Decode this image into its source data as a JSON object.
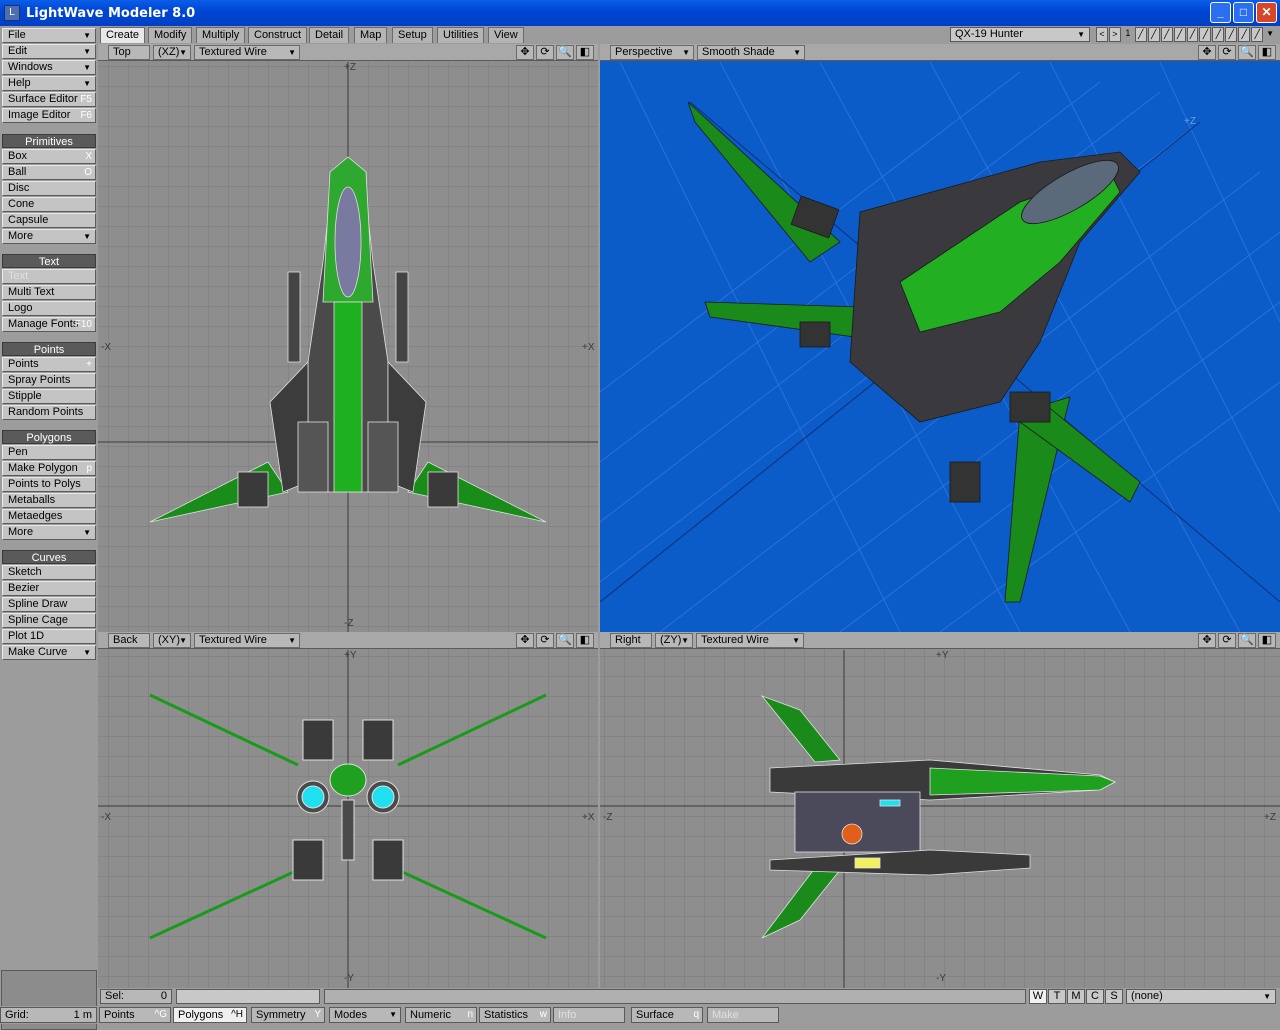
{
  "window": {
    "title": "LightWave Modeler 8.0",
    "app_icon": "lw-icon"
  },
  "menu": [
    {
      "label": "File",
      "dropdown": true
    },
    {
      "label": "Edit",
      "dropdown": true
    },
    {
      "label": "Windows",
      "dropdown": true
    },
    {
      "label": "Help",
      "dropdown": true
    },
    {
      "label": "Surface Editor",
      "shortcut": "F5"
    },
    {
      "label": "Image Editor",
      "shortcut": "F6"
    }
  ],
  "sections": {
    "primitives": {
      "title": "Primitives",
      "items": [
        {
          "label": "Box",
          "shortcut": "X"
        },
        {
          "label": "Ball",
          "shortcut": "O"
        },
        {
          "label": "Disc",
          "shortcut": ""
        },
        {
          "label": "Cone",
          "shortcut": ""
        },
        {
          "label": "Capsule",
          "shortcut": ""
        },
        {
          "label": "More",
          "shortcut": ""
        }
      ]
    },
    "text": {
      "title": "Text",
      "items": [
        {
          "label": "Text",
          "shortcut": ""
        },
        {
          "label": "Multi Text",
          "shortcut": ""
        },
        {
          "label": "Logo",
          "shortcut": ""
        },
        {
          "label": "Manage Fonts",
          "shortcut": "F10"
        }
      ]
    },
    "points": {
      "title": "Points",
      "items": [
        {
          "label": "Points",
          "shortcut": "+"
        },
        {
          "label": "Spray Points",
          "shortcut": ""
        },
        {
          "label": "Stipple",
          "shortcut": ""
        },
        {
          "label": "Random Points",
          "shortcut": ""
        }
      ]
    },
    "polygons": {
      "title": "Polygons",
      "items": [
        {
          "label": "Pen",
          "shortcut": ""
        },
        {
          "label": "Make Polygon",
          "shortcut": "p"
        },
        {
          "label": "Points to Polys",
          "shortcut": ""
        },
        {
          "label": "Metaballs",
          "shortcut": ""
        },
        {
          "label": "Metaedges",
          "shortcut": ""
        },
        {
          "label": "More",
          "shortcut": ""
        }
      ]
    },
    "curves": {
      "title": "Curves",
      "items": [
        {
          "label": "Sketch",
          "shortcut": ""
        },
        {
          "label": "Bezier",
          "shortcut": ""
        },
        {
          "label": "Spline Draw",
          "shortcut": ""
        },
        {
          "label": "Spline Cage",
          "shortcut": ""
        },
        {
          "label": "Plot 1D",
          "shortcut": ""
        },
        {
          "label": "Make Curve",
          "shortcut": ""
        }
      ]
    }
  },
  "tabs": [
    "Create",
    "Modify",
    "Multiply",
    "Construct",
    "Detail",
    "Map",
    "Setup",
    "Utilities",
    "View"
  ],
  "active_tab": "Create",
  "object_selector": "QX-19 Hunter",
  "layer_number": "1",
  "viewports": {
    "top": {
      "view": "Top",
      "axes": "(XZ)",
      "mode": "Textured Wire",
      "labels": {
        "top": "+Z",
        "bottom": "-Z",
        "left": "-X",
        "right": "+X"
      }
    },
    "perspective": {
      "view": "Perspective",
      "mode": "Smooth Shade",
      "labels": {
        "axis": "+Z"
      }
    },
    "back": {
      "view": "Back",
      "axes": "(XY)",
      "mode": "Textured Wire",
      "labels": {
        "top": "+Y",
        "bottom": "-Y",
        "left": "-X",
        "right": "+X"
      }
    },
    "right": {
      "view": "Right",
      "axes": "(ZY)",
      "mode": "Textured Wire",
      "labels": {
        "top": "+Y",
        "bottom": "-Y",
        "left": "-Z",
        "right": "+Z"
      }
    }
  },
  "status": {
    "sel_label": "Sel:",
    "sel_value": "0",
    "wtmcs": [
      "W",
      "T",
      "M",
      "C",
      "S"
    ],
    "surface_value": "(none)"
  },
  "bottom": {
    "grid_label": "Grid:",
    "grid_value": "1 m",
    "buttons": [
      {
        "label": "Points",
        "shortcut": "^G"
      },
      {
        "label": "Polygons",
        "shortcut": "^H"
      },
      {
        "label": "Symmetry",
        "shortcut": "Y"
      },
      {
        "label": "Modes",
        "shortcut": ""
      },
      {
        "label": "Numeric",
        "shortcut": "n"
      },
      {
        "label": "Statistics",
        "shortcut": "w"
      },
      {
        "label": "Info",
        "shortcut": ""
      },
      {
        "label": "Surface",
        "shortcut": "q"
      },
      {
        "label": "Make",
        "shortcut": ""
      }
    ]
  },
  "colors": {
    "accent_green": "#1a9a1a",
    "persp_bg": "#0b5cc8",
    "grid_bg": "#8e8e8e",
    "titlebar": "#0046d5"
  }
}
